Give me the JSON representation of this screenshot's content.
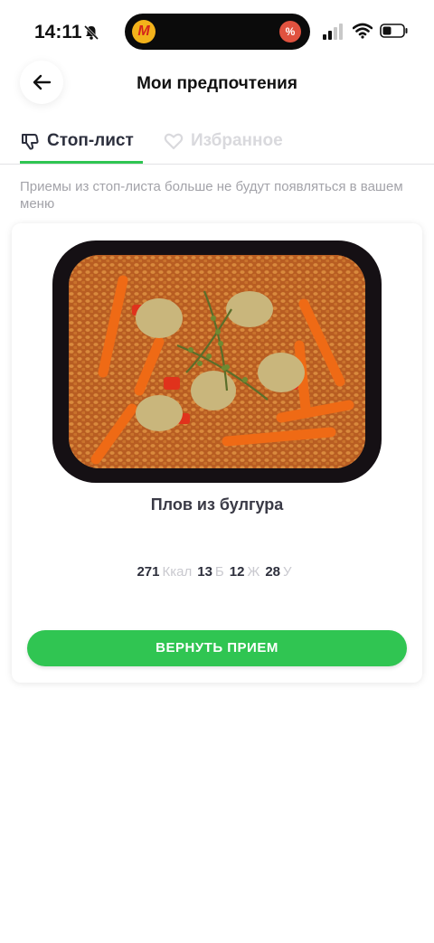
{
  "status_bar": {
    "time": "14:11",
    "app_icon_letter": "M",
    "app_badge": "%"
  },
  "header": {
    "title": "Мои предпочтения"
  },
  "tabs": [
    {
      "label": "Стоп-лист",
      "active": true
    },
    {
      "label": "Избранное",
      "active": false
    }
  ],
  "hint": "Приемы из стоп-листа больше не будут появляться в вашем меню",
  "dish": {
    "name": "Плов из булгура",
    "nutrition": {
      "kcal": "271",
      "kcal_unit": "Ккал",
      "protein": "13",
      "protein_unit": "Б",
      "fat": "12",
      "fat_unit": "Ж",
      "carbs": "28",
      "carbs_unit": "У"
    },
    "button_label": "ВЕРНУТЬ ПРИЕМ"
  },
  "colors": {
    "accent": "#30c552",
    "inactive_tab": "#d9d9dd",
    "hint_text": "#a3a3a9"
  }
}
